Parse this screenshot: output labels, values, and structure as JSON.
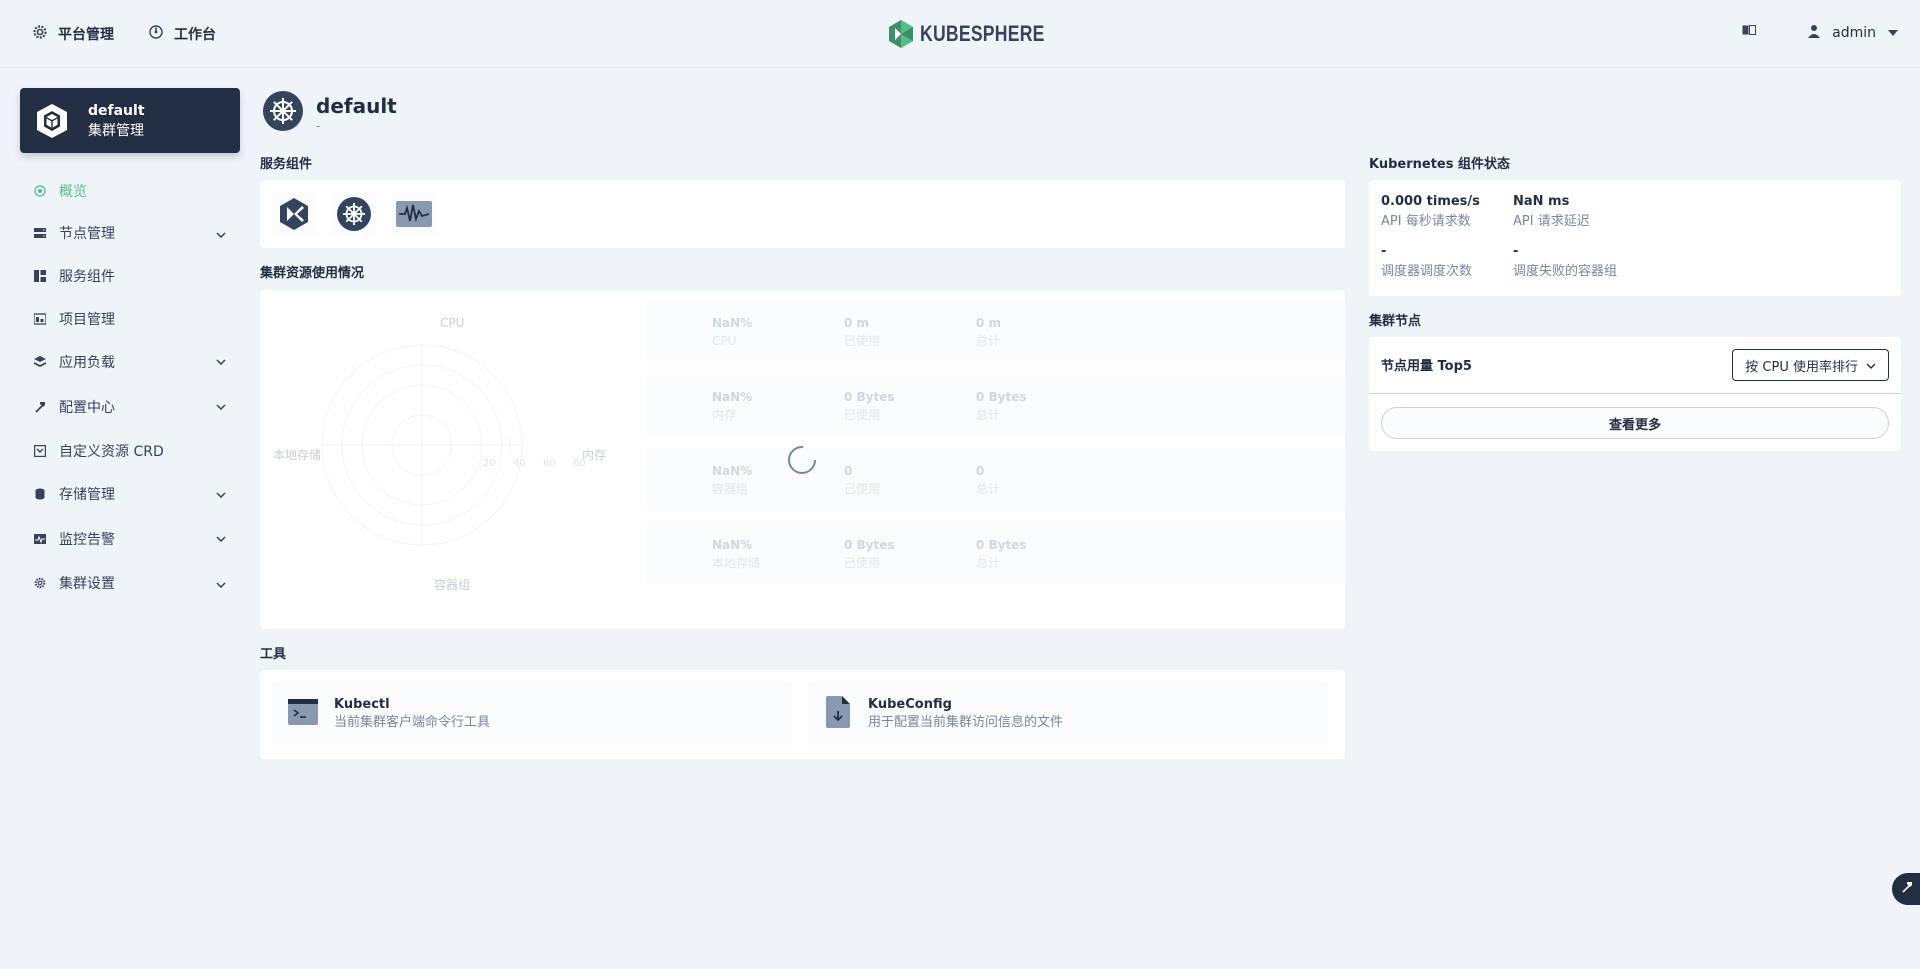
{
  "header": {
    "platform_label": "平台管理",
    "workbench_label": "工作台",
    "brand": "KUBESPHERE",
    "user": "admin"
  },
  "sidebar": {
    "cluster_name": "default",
    "cluster_sub": "集群管理",
    "items": [
      {
        "label": "概览",
        "icon": "overview-icon",
        "active": true
      },
      {
        "label": "节点管理",
        "icon": "nodes-icon",
        "expandable": true
      },
      {
        "label": "服务组件",
        "icon": "components-icon"
      },
      {
        "label": "项目管理",
        "icon": "projects-icon"
      },
      {
        "label": "应用负载",
        "icon": "workloads-icon",
        "expandable": true
      },
      {
        "label": "配置中心",
        "icon": "config-icon",
        "expandable": true
      },
      {
        "label": "自定义资源 CRD",
        "icon": "crd-icon"
      },
      {
        "label": "存储管理",
        "icon": "storage-icon",
        "expandable": true
      },
      {
        "label": "监控告警",
        "icon": "monitoring-icon",
        "expandable": true
      },
      {
        "label": "集群设置",
        "icon": "settings-icon",
        "expandable": true
      }
    ]
  },
  "page": {
    "title": "default",
    "subtitle": "-"
  },
  "sections": {
    "service_components": "服务组件",
    "cluster_resources": "集群资源使用情况",
    "tools": "工具",
    "k8s_status": "Kubernetes 组件状态",
    "cluster_nodes": "集群节点"
  },
  "radar": {
    "axes": [
      "CPU",
      "内存",
      "容器组",
      "本地存储"
    ],
    "ticks": [
      "20",
      "40",
      "60",
      "80"
    ]
  },
  "resources": [
    {
      "pct": "NaN%",
      "name": "CPU",
      "used": "0 m",
      "used_label": "已使用",
      "total": "0 m",
      "total_label": "总计"
    },
    {
      "pct": "NaN%",
      "name": "内存",
      "used": "0 Bytes",
      "used_label": "已使用",
      "total": "0 Bytes",
      "total_label": "总计"
    },
    {
      "pct": "NaN%",
      "name": "容器组",
      "used": "0",
      "used_label": "已使用",
      "total": "0",
      "total_label": "总计"
    },
    {
      "pct": "NaN%",
      "name": "本地存储",
      "used": "0 Bytes",
      "used_label": "已使用",
      "total": "0 Bytes",
      "total_label": "总计"
    }
  ],
  "tools": [
    {
      "title": "Kubectl",
      "desc": "当前集群客户端命令行工具",
      "icon": "terminal-icon"
    },
    {
      "title": "KubeConfig",
      "desc": "用于配置当前集群访问信息的文件",
      "icon": "file-download-icon"
    }
  ],
  "k8s": {
    "api_rate": "0.000 times/s",
    "api_rate_label": "API 每秒请求数",
    "api_latency": "NaN ms",
    "api_latency_label": "API 请求延迟",
    "sched_count": "-",
    "sched_count_label": "调度器调度次数",
    "sched_failed": "-",
    "sched_failed_label": "调度失败的容器组"
  },
  "nodes": {
    "title": "节点用量 Top5",
    "sort_select": "按 CPU 使用率排行",
    "more_button": "查看更多"
  },
  "colors": {
    "accent": "#55bc8a",
    "dark": "#242e42",
    "background": "#eff4f9"
  }
}
